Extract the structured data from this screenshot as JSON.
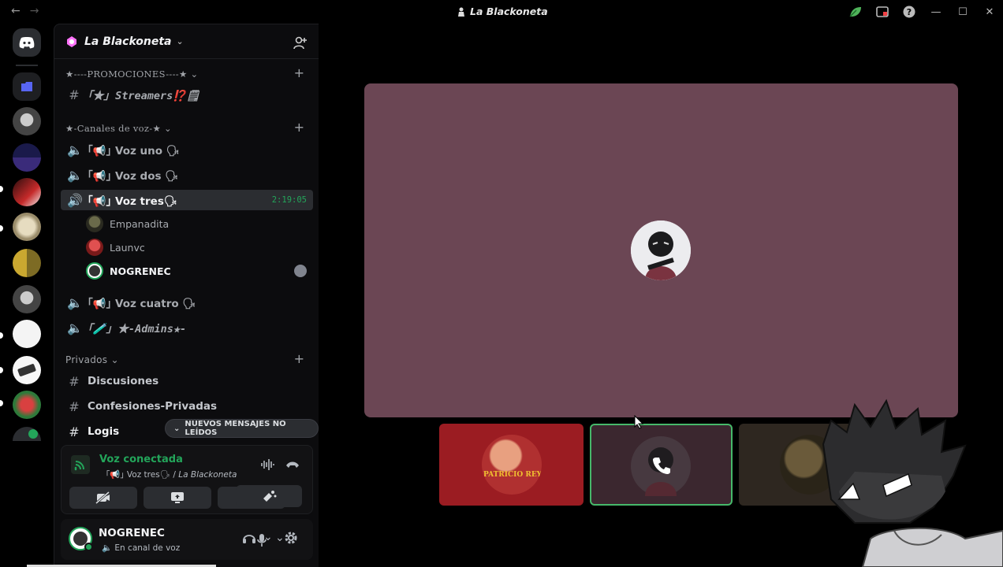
{
  "window": {
    "title": "La Blackoneta",
    "accent": "#23a55a"
  },
  "server": {
    "name": "La Blackoneta"
  },
  "categories": [
    {
      "label": "★----PROMOCIONES----★"
    },
    {
      "label": "★-Canales de voz-★"
    },
    {
      "label": "Privados"
    }
  ],
  "channels": {
    "streamers": "｢★｣ Streamers⁉️🗒",
    "voz_uno": "｢📢｣ Voz uno 🗣",
    "voz_dos": "｢📢｣ Voz dos 🗣",
    "voz_tres": "｢📢｣ Voz tres🗣",
    "voz_tres_timer": "2:19:05",
    "voz_cuatro": "｢📢｣ Voz cuatro 🗣",
    "admins": "｢🧪｣ ★-Admins★-",
    "discusiones": "Discusiones",
    "confesiones": "Confesiones-Privadas",
    "logs": "Logis"
  },
  "voice_users": [
    {
      "name": "Empanadita"
    },
    {
      "name": "Launvc"
    },
    {
      "name": "NOGRENEC"
    }
  ],
  "new_messages": "NUEVOS MENSAJES NO LEÍDOS",
  "voice_panel": {
    "status": "Voz conectada",
    "channel": "｢📢｣ Voz tres🗣",
    "separator": "/",
    "server": "La Blackoneta"
  },
  "user_panel": {
    "name": "NOGRENEC",
    "status": "En canal de voz"
  },
  "stream": {
    "thumb_text": "PATRICIO REY"
  }
}
